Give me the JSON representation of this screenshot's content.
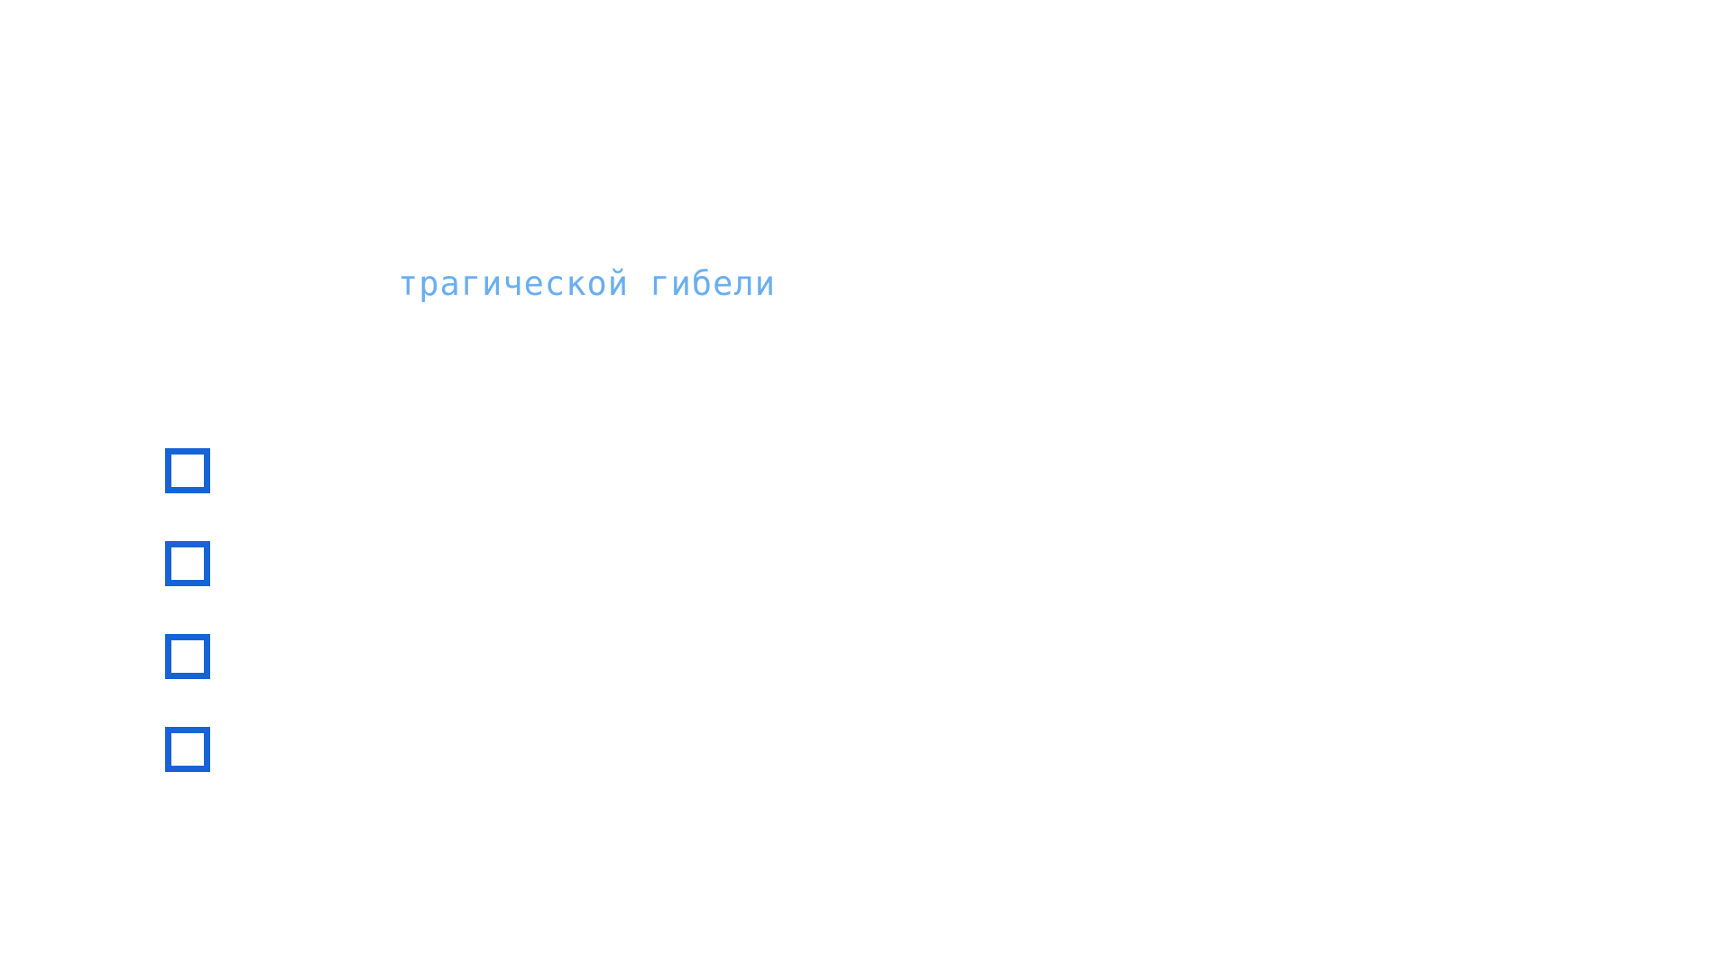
{
  "colors": {
    "background": "#ffffff",
    "headline_text": "#6aaef0",
    "checkbox_border": "#1763d6"
  },
  "headline": {
    "text": "трагической гибели"
  },
  "options": [
    {
      "checked": false
    },
    {
      "checked": false
    },
    {
      "checked": false
    },
    {
      "checked": false
    }
  ]
}
